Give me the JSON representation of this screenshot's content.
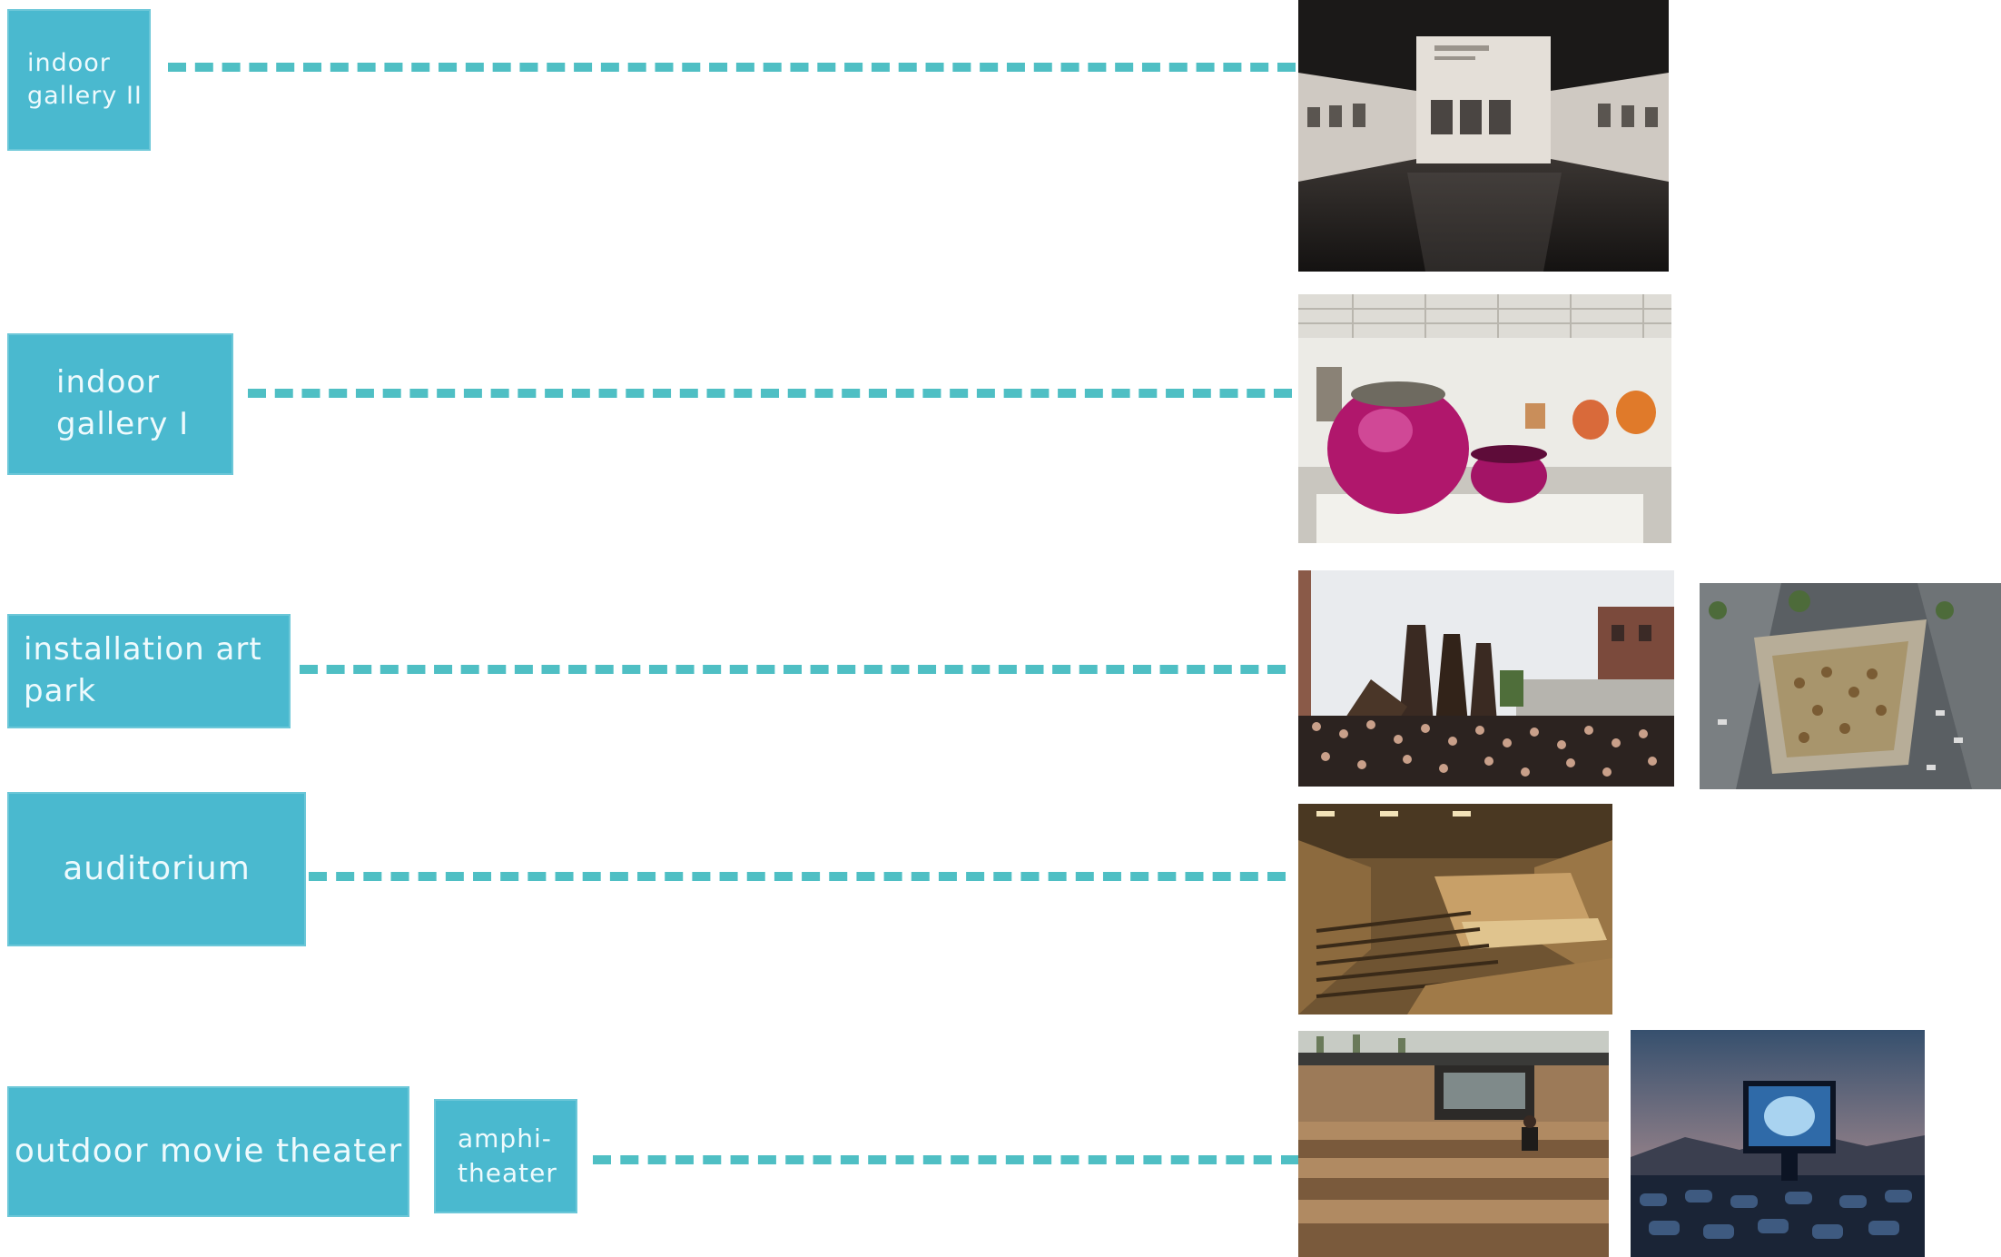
{
  "labels": {
    "indoor_gallery_2": {
      "line1": "indoor",
      "line2": "gallery II"
    },
    "indoor_gallery_1": {
      "line1": "indoor",
      "line2": "gallery I"
    },
    "installation_art_park": {
      "line1": "installation art",
      "line2": "park"
    },
    "auditorium": {
      "line1": "auditorium"
    },
    "outdoor_movie_theater": {
      "line1": "outdoor movie theater"
    },
    "amphitheater": {
      "line1": "amphi-",
      "line2": "theater"
    }
  },
  "colors": {
    "label_fill": "#4ab9cf",
    "label_text": "#eefafd",
    "connector": "#4fbfc4"
  }
}
